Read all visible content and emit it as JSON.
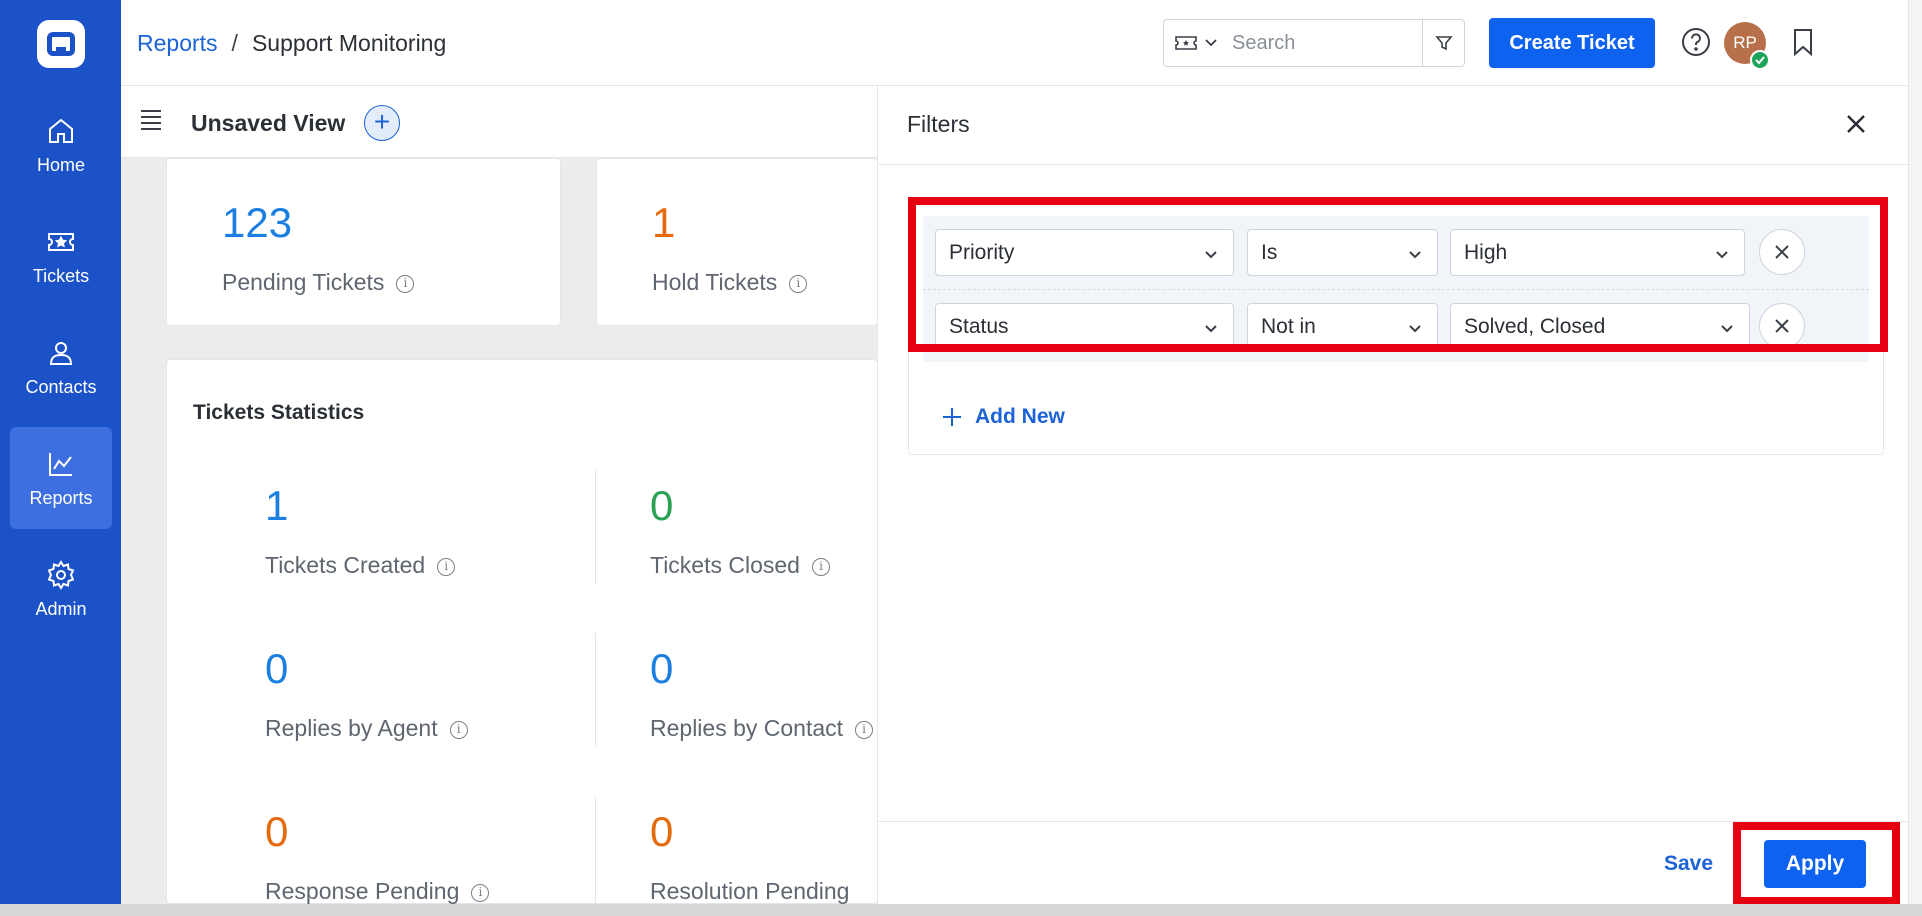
{
  "sidebar": {
    "items": [
      {
        "label": "Home",
        "icon": "home-icon"
      },
      {
        "label": "Tickets",
        "icon": "ticket-icon"
      },
      {
        "label": "Contacts",
        "icon": "person-icon"
      },
      {
        "label": "Reports",
        "icon": "chart-icon",
        "active": true
      },
      {
        "label": "Admin",
        "icon": "gear-icon"
      }
    ]
  },
  "header": {
    "breadcrumb_root": "Reports",
    "breadcrumb_sep": "/",
    "breadcrumb_current": "Support Monitoring",
    "search_placeholder": "Search",
    "create_ticket": "Create Ticket",
    "avatar_initials": "RP"
  },
  "view": {
    "title": "Unsaved View",
    "add_symbol": "+"
  },
  "summary": [
    {
      "value": "123",
      "label": "Pending Tickets"
    },
    {
      "value": "1",
      "label": "Hold Tickets"
    }
  ],
  "statistics": {
    "title": "Tickets Statistics",
    "items": [
      {
        "value": "1",
        "label": "Tickets Created"
      },
      {
        "value": "0",
        "label": "Tickets Closed"
      },
      {
        "value": "0",
        "label": "Replies by Agent"
      },
      {
        "value": "0",
        "label": "Replies by Contact"
      },
      {
        "value": "0",
        "label": "Response Pending"
      },
      {
        "value": "0",
        "label": "Resolution Pending"
      }
    ]
  },
  "filters": {
    "title": "Filters",
    "conditions": [
      {
        "field": "Priority",
        "operator": "Is",
        "value": "High"
      },
      {
        "field": "Status",
        "operator": "Not in",
        "value": "Solved, Closed"
      }
    ],
    "add_new": "Add New",
    "save": "Save",
    "apply": "Apply"
  },
  "colors": {
    "sidebar": "#1b52c8",
    "primary": "#0d62f0",
    "highlight": "#e60012"
  }
}
